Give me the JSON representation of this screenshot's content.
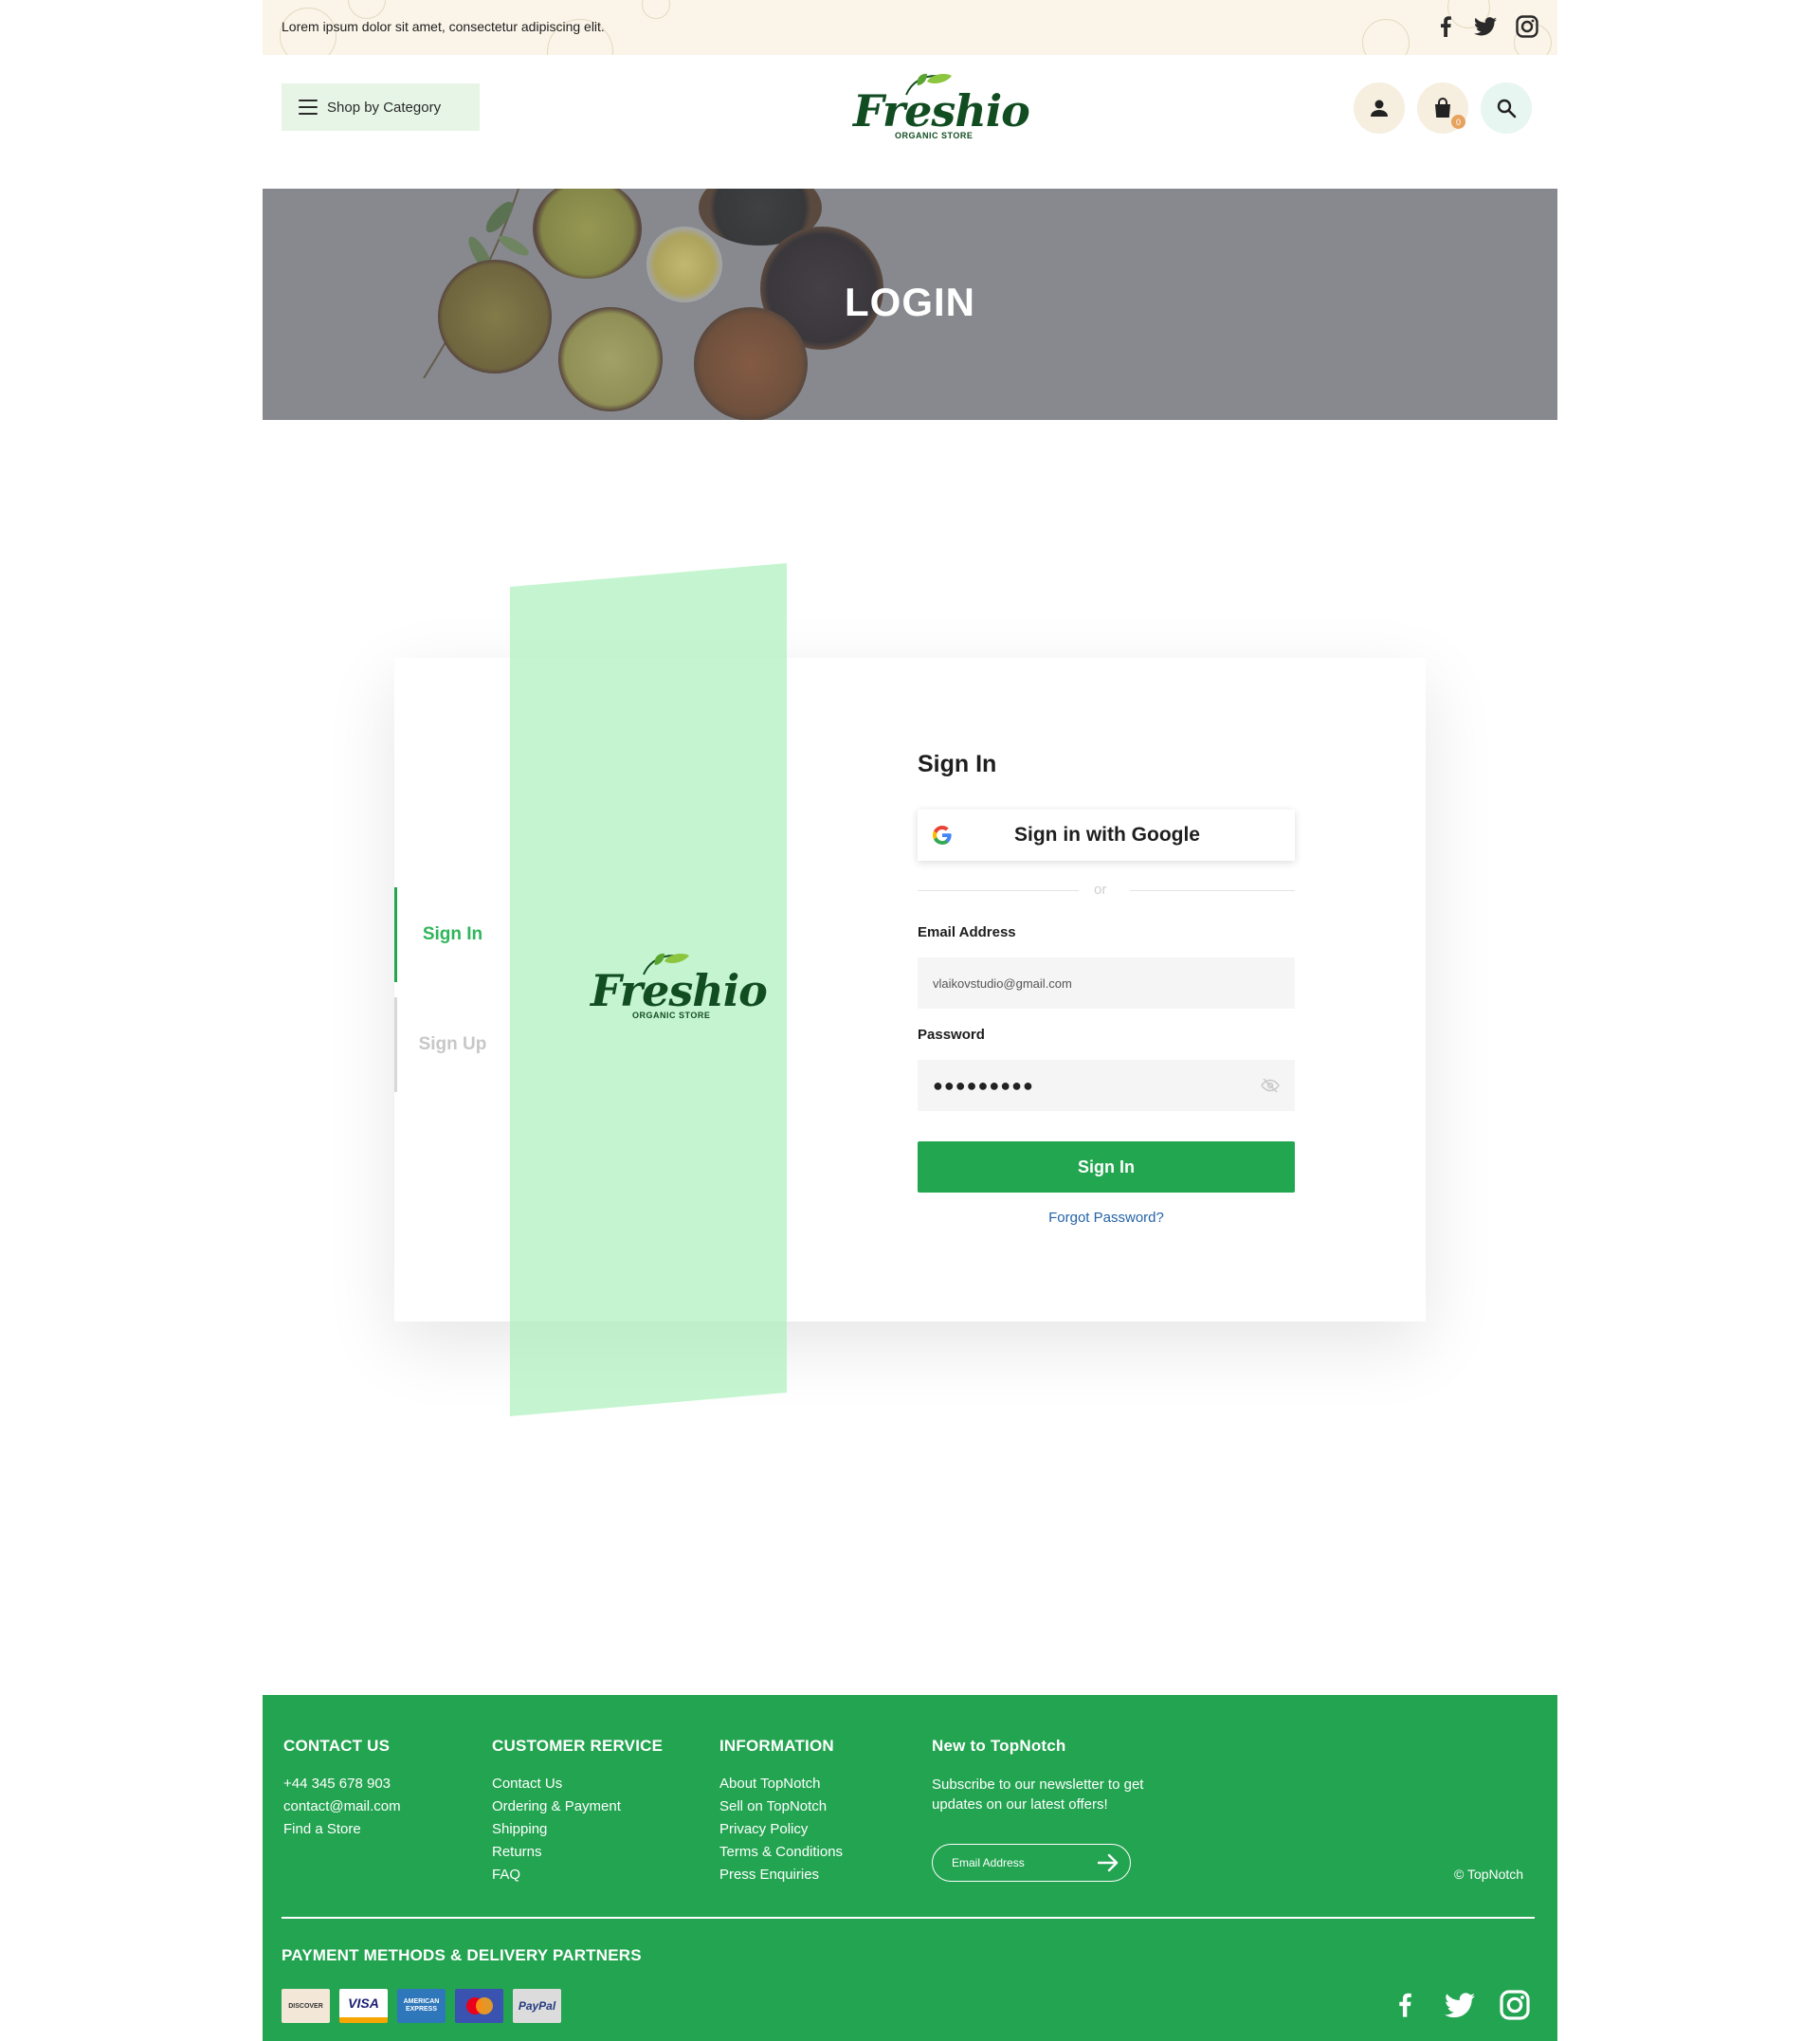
{
  "topbar": {
    "tagline": "Lorem ipsum dolor sit amet, consectetur adipiscing elit.",
    "social": [
      "facebook-icon",
      "twitter-icon",
      "instagram-icon"
    ]
  },
  "header": {
    "category_label": "Shop by Category",
    "logo": {
      "word": "Freshio",
      "sub": "ORGANIC STORE"
    },
    "cart_count": "0"
  },
  "hero": {
    "title": "LOGIN"
  },
  "auth": {
    "tabs": {
      "signin": "Sign In",
      "signup": "Sign Up"
    },
    "title": "Sign In",
    "google_label": "Sign in with Google",
    "or_text": "or",
    "email_label": "Email Address",
    "email_value": "vlaikovstudio@gmail.com",
    "password_label": "Password",
    "password_mask": "●●●●●●●●●",
    "submit_label": "Sign In",
    "forgot_label": "Forgot Password?"
  },
  "footer": {
    "contact": {
      "heading": "CONTACT US",
      "lines": [
        "+44 345 678 903",
        "contact@mail.com",
        "Find a Store"
      ]
    },
    "service": {
      "heading": "CUSTOMER RERVICE",
      "links": [
        "Contact Us",
        "Ordering & Payment",
        "Shipping",
        "Returns",
        "FAQ"
      ]
    },
    "information": {
      "heading": "INFORMATION",
      "links": [
        "About TopNotch",
        "Sell on TopNotch",
        "Privacy Policy",
        "Terms & Conditions",
        "Press Enquiries"
      ]
    },
    "newsletter": {
      "heading": "New to TopNotch",
      "text": "Subscribe to our newsletter to get updates on our latest offers!",
      "placeholder": "Email Address"
    },
    "copyright": "© TopNotch",
    "payments_heading": "PAYMENT METHODS & DELIVERY PARTNERS",
    "payments": [
      "DISCOVER",
      "VISA",
      "AMERICAN EXPRESS",
      "mastercard",
      "PayPal"
    ]
  },
  "colors": {
    "brand_green": "#23a451",
    "accent_green": "#2fb55a",
    "link_blue": "#2463a8",
    "topbar_bg": "#fbf4e8",
    "panel_green": "#aaf0b9"
  }
}
